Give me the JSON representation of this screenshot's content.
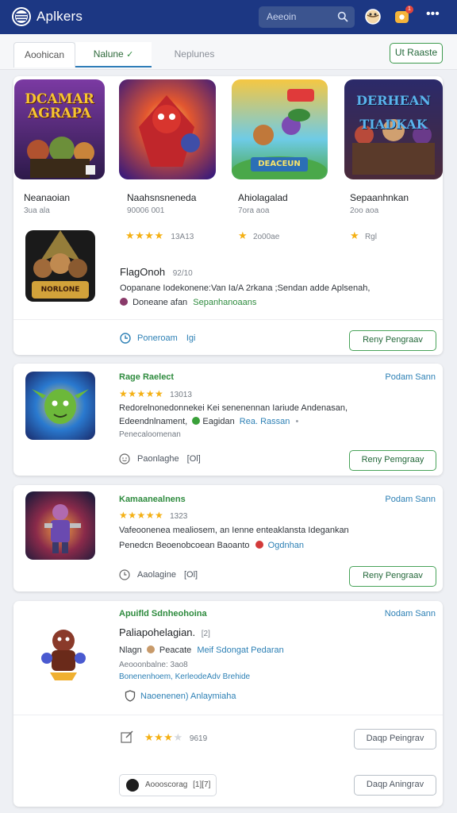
{
  "app": {
    "brand": "Aplkers",
    "search_placeholder": "Aeeoin",
    "badge_count": "1",
    "more": "•••"
  },
  "tabs": [
    {
      "label": "Aoohican"
    },
    {
      "label": "Nalune",
      "check": "✓"
    },
    {
      "label": "Neplunes"
    }
  ],
  "header_button": "Ut Raaste",
  "featured": {
    "games": [
      {
        "title": "Neanaoian",
        "sub": "3ua ala",
        "tile_text": "DCAMAR AGRAPA"
      },
      {
        "title": "Naahsnsneneda",
        "sub": "90006 001",
        "stars": "★★★★",
        "rating": "13A13"
      },
      {
        "title": "Ahiolagalad",
        "sub": "7ora aoa",
        "stars": "★",
        "rating": "2o00ae"
      },
      {
        "title": "Sepaanhnkan",
        "sub": "2oo aoa",
        "stars": "★",
        "rating": "Rgl"
      }
    ],
    "tile4_text": "DERHEAN TIADKAK",
    "tile3_text": "DEACEUN",
    "detail": {
      "thumb_text": "NORLONE",
      "title": "FlagOnoh",
      "meta": "92/10",
      "desc": "Oopanane Iodekonene:Van Ia/A 2rkana ;Sendan adde Aplsenah,",
      "tag": "Doneane afan",
      "tag_link": "Sepanhanoaans",
      "link": "Poneroam",
      "link2": "Igi",
      "button": "Reny Pengraav"
    }
  },
  "list": [
    {
      "title": "Rage Raelect",
      "right": "Podam  Sann",
      "stars": "★★★★★",
      "rating": "13013",
      "desc1": "Redorelnonedonnekei Kei senenennan Iariude Andenasan,",
      "desc2": "Edeendnlnament,",
      "desc2b": "Eagidan",
      "desc2_link": "Rea. Rassan",
      "desc2_tail": "•",
      "small": "Penecaloomenan",
      "foot": "Paonlaghe",
      "foot2": "[Ol]",
      "button": "Reny Pemgraay"
    },
    {
      "title": "Kamaanealnens",
      "right": "Podam  Sann",
      "stars": "★★★★★",
      "rating": "1323",
      "desc1": "Vafeoonenea mealiosem, an Ienne enteaklansta Idegankan",
      "desc2": "Penedcn Beoenobcoean Baoanto",
      "desc2_link": "Ogdnhan",
      "foot": "Aaolagine",
      "foot2": "[Ol]",
      "button": "Reny Pengraav"
    },
    {
      "title": "Apuifld Sdnheohoina",
      "right": "Nodam  Sann",
      "heading": "Paliapohelagian.",
      "heading_tag": "[2]",
      "line1a": "Nlagn",
      "line1b": "Peacate",
      "line1_link": "Meif Sdongat Pedaran",
      "line2": "Aeooonbalne: 3ao8",
      "line3": "Bonenenhoem, KerleodeAdv Brehide",
      "shield_text": "Naoenenen) Anlaymiaha",
      "stars": "★★★",
      "star_dim": "★",
      "rating": "9619",
      "button": "Daqp Peingrav",
      "foot": "Aoooscorag",
      "foot2": "[1][7]",
      "button2": "Daqp Aningrav"
    }
  ],
  "colors": {
    "topbar": "#1c3783",
    "accent_green": "#2e8b3e",
    "link_blue": "#2d80b5",
    "star": "#f4b014"
  }
}
